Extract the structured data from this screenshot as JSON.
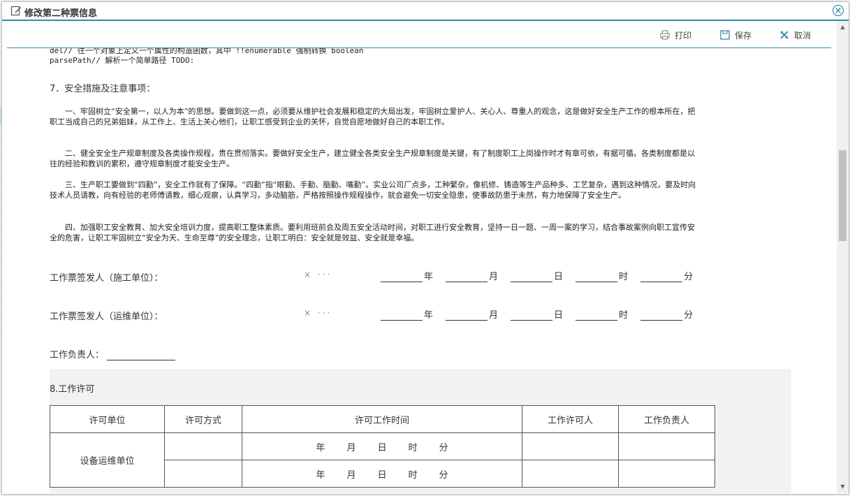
{
  "dialog": {
    "title": "修改第二种票信息"
  },
  "toolbar": {
    "print": "打印",
    "save": "保存",
    "cancel": "取消"
  },
  "doc": {
    "code_line1": "del// 往一个对象上定义一个属性的构造函数，其中 !!enumerable 强制转换 boolean",
    "code_line2": "parsePath// 解析一个简单路径 TODO:",
    "section7_title": "7．安全措施及注意事项：",
    "para1": "一、牢固树立“安全第一，以人为本”的思想。要做到这一点，必须要从维护社会发展和稳定的大局出发，牢固树立爱护人、关心人、尊重人的观念，这是做好安全生产工作的根本所在，把职工当成自己的兄弟姐妹，从工作上、生活上关心他们，让职工感受到企业的关怀，自觉自愿地做好自己的本职工作。",
    "para2": "二、健全安全生产规章制度及各类操作规程，贵在贯彻落实。要做好安全生产，建立健全各类安全生产规章制度是关键，有了制度职工上岗操作时才有章可依，有据可循。各类制度都是以往的经验和教训的累积，遵守规章制度才能安全生产。",
    "para3": "三、生产职工要做到“四勤”，安全工作就有了保障。“四勤”指“眼勤、手勤、脑勤、嘴勤”。实业公司厂点多，工种繁杂，像机修、铸造等生产品种多、工艺复杂，遇到这种情况，要及时向技术人员请教，向有经验的老师傅请教，细心观察，认真学习，多动脑筋，严格按照操作规程操作，就会避免一切安全隐患，使事故防患于未然，有力地保障了安全生产。",
    "para4": "四、加强职工安全教育、加大安全培训力度，提高职工整体素质。要利用班前会及周五安全活动时间，对职工进行安全教育，坚持一日一题、一周一案的学习，结合事故案例向职工宣传安全的危害，让职工牢固树立“安全为天、生命至尊”的安全理念，让职工明白：安全就是效益、安全就是幸福。",
    "signer1_label": "工作票签发人（施工单位）：",
    "signer2_label": "工作票签发人（运维单位）：",
    "clear_glyph": "×",
    "more_glyph": "···",
    "date_units": {
      "year": "年",
      "month": "月",
      "day": "日",
      "hour": "时",
      "minute": "分"
    },
    "responsible_label": "工作负责人："
  },
  "permit": {
    "section_title": "8.工作许可",
    "headers": [
      "许可单位",
      "许可方式",
      "许可工作时间",
      "工作许可人",
      "工作负责人"
    ],
    "row_unit": "设备运维单位"
  }
}
